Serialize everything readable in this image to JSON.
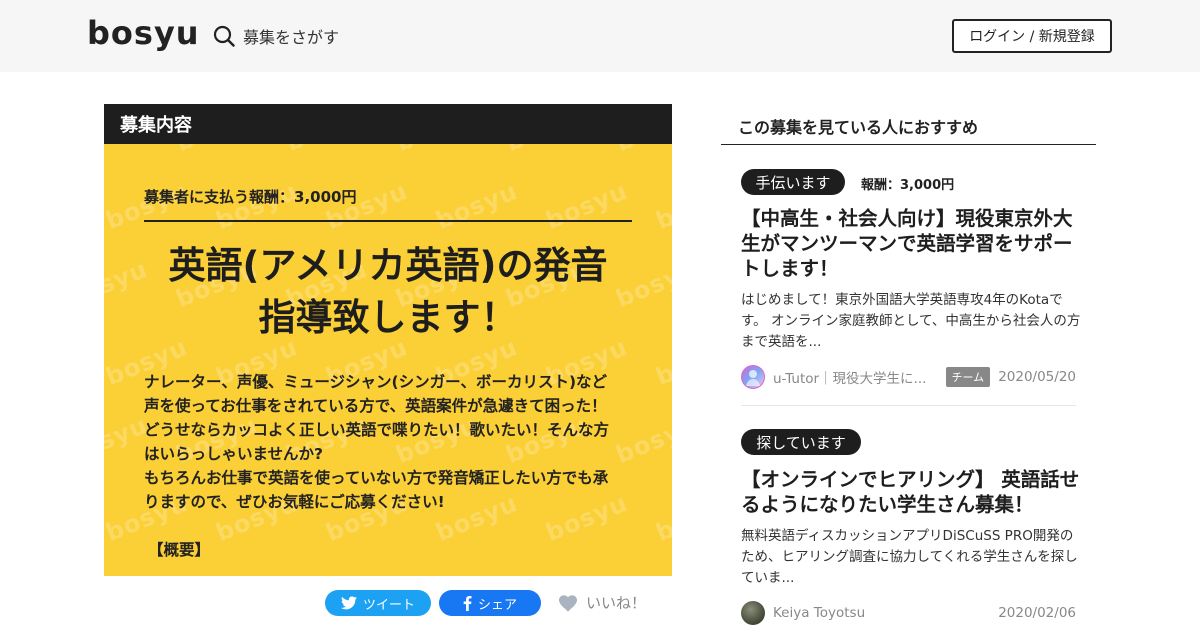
{
  "header": {
    "logo": "bosyu",
    "search_label": "募集をさがす",
    "login_label": "ログイン / 新規登録"
  },
  "card": {
    "heading": "募集内容",
    "watermark": "bosyu",
    "reward_line": "募集者に支払う報酬：3,000円",
    "title": "英語(アメリカ英語)の発音\n指導致します！",
    "description": "ナレーター、声優、ミュージシャン(シンガー、ボーカリスト)など\n声を使ってお仕事をされている方で、英語案件が急遽きて困った！\nどうせならカッコよく正しい英語で喋りたい！歌いたい！そんな方\nはいらっしゃいませんか?\nもちろんお仕事で英語を使っていない方で発音矯正したい方でも承\nりますので、ぜひお気軽にご応募ください!",
    "overview_label": "【概要】"
  },
  "share": {
    "tweet_label": "ツイート",
    "facebook_label": "シェア",
    "like_label": "いいね！"
  },
  "sidebar": {
    "title": "この募集を見ている人におすすめ",
    "items": [
      {
        "tag": "手伝います",
        "reward": "報酬：3,000円",
        "title": "【中高生・社会人向け】現役東京外大生がマンツーマンで英語学習をサポートします！",
        "excerpt": "はじめまして！東京外国語大学英語専攻4年のKotaです。 オンライン家庭教師として、中高生から社会人の方まで英語を...",
        "author": "u-Tutor｜現役大学生に...",
        "badge": "チーム",
        "date": "2020/05/20"
      },
      {
        "tag": "探しています",
        "title": "【オンラインでヒアリング】 英語話せるようになりたい学生さん募集！",
        "excerpt": "無料英語ディスカッションアプリDiSCuSS PRO開発のため、ヒアリング調査に協力してくれる学生さんを探していま...",
        "author": "Keiya Toyotsu",
        "date": "2020/02/06"
      }
    ]
  },
  "colors": {
    "accent_yellow": "#fbcf36",
    "dark": "#1e1e1e",
    "twitter": "#1da1f2",
    "facebook": "#1877f2"
  },
  "icons": [
    "search-icon",
    "twitter-icon",
    "facebook-icon",
    "heart-icon"
  ]
}
